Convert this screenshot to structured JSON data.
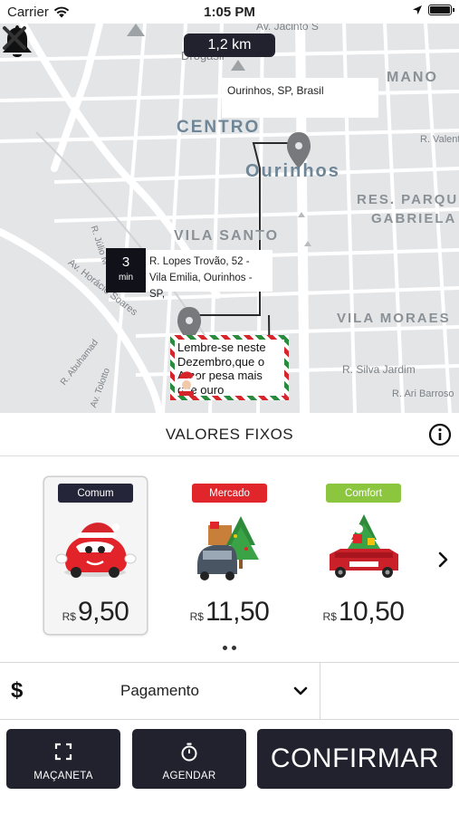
{
  "status_bar": {
    "carrier": "Carrier",
    "time": "1:05 PM"
  },
  "map": {
    "distance": "1,2 km",
    "destination_bubble": "Ourinhos, SP, Brasil",
    "eta": {
      "value": "3",
      "unit": "min",
      "address": "R. Lopes Trovão, 52 - Vila Emilia, Ourinhos - SP,"
    },
    "promo_note": "Lembre-se neste Dezembro,que o Amor pesa mais que ouro",
    "labels": {
      "centro": "CENTRO",
      "ourinhos": "Ourinhos",
      "vila_santo": "VILA SANTO",
      "res_parque": "RES. PARQU",
      "gabriela": "GABRIELA",
      "vila_moraes": "VILA MORAES",
      "mano": "MANO",
      "r_valenti": "R. Valenti",
      "r_silva_jardim": "R. Silva Jardim",
      "r_ari_barroso": "R. Ari Barroso",
      "av_horacio_soares": "Av. Horácio Soares",
      "r_julio_mesquita": "R. Júlio M",
      "r_abuhamad": "R. Abuhamad",
      "av_tolotto": "Av. Tolotto",
      "av_jacinto": "Av. Jacinto S",
      "drogasil": "Drogasil"
    }
  },
  "section": {
    "title": "VALORES FIXOS"
  },
  "vehicles": [
    {
      "badge": "Comum",
      "badge_color": "#25253a",
      "currency": "R$",
      "price": "9,50",
      "selected": true
    },
    {
      "badge": "Mercado",
      "badge_color": "#e0252b",
      "currency": "R$",
      "price": "11,50",
      "selected": false
    },
    {
      "badge": "Comfort",
      "badge_color": "#8cc63f",
      "currency": "R$",
      "price": "10,50",
      "selected": false
    }
  ],
  "payment": {
    "symbol": "$",
    "label": "Pagamento"
  },
  "actions": {
    "handle_label": "MAÇANETA",
    "schedule_label": "AGENDAR",
    "confirm_label": "CONFIRMAR"
  },
  "colors": {
    "dark": "#22222e",
    "map_bg": "#e4e5e7",
    "road": "#ffffff",
    "red": "#e0252b",
    "green": "#8cc63f"
  }
}
